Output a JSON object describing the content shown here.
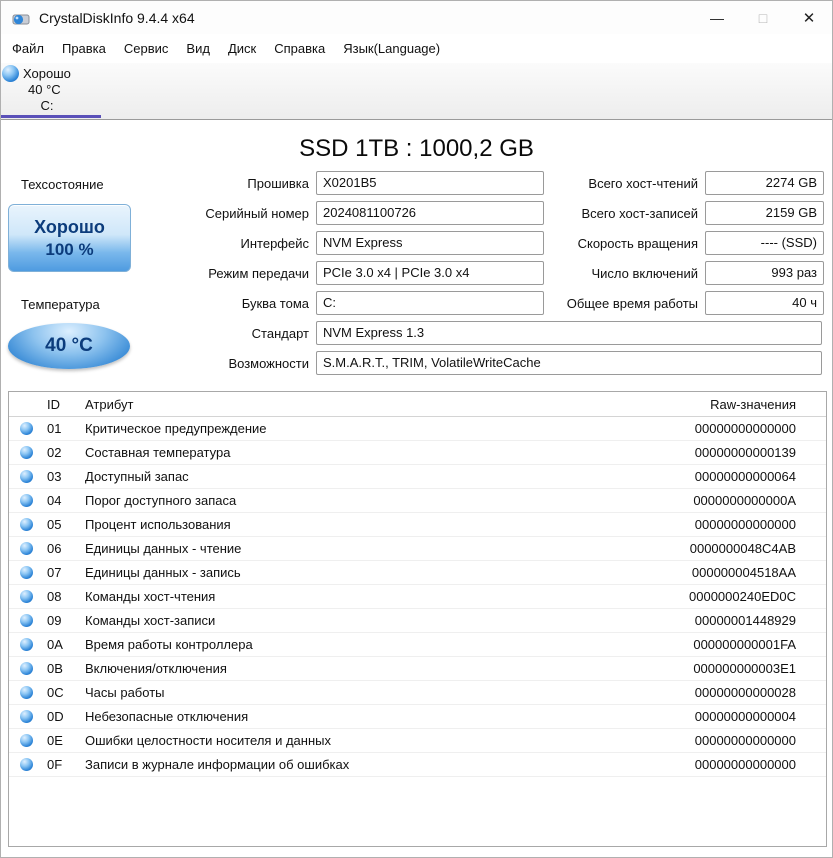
{
  "colors": {
    "status_blue": "#2f86d8",
    "drive_tab_underline": "#5a50b8",
    "health_text": "#0c3c7c"
  },
  "window": {
    "title": "CrystalDiskInfo 9.4.4 x64",
    "icons": {
      "minimize": "—",
      "maximize": "□",
      "close": "✕"
    }
  },
  "menu": {
    "items": [
      {
        "id": "file",
        "label": "Файл"
      },
      {
        "id": "edit",
        "label": "Правка"
      },
      {
        "id": "function",
        "label": "Сервис"
      },
      {
        "id": "view",
        "label": "Вид"
      },
      {
        "id": "disk",
        "label": "Диск"
      },
      {
        "id": "help",
        "label": "Справка"
      },
      {
        "id": "language",
        "label": "Язык(Language)"
      }
    ]
  },
  "drive_bar": {
    "status": "Хорошо",
    "temperature": "40 °C",
    "letter": "C:"
  },
  "main": {
    "title": "SSD 1TB : 1000,2 GB",
    "health": {
      "label": "Техсостояние",
      "status": "Хорошо",
      "percent": "100 %"
    },
    "temperature": {
      "label": "Температура",
      "value": "40 °C"
    },
    "fields_mid": [
      {
        "id": "firmware",
        "label": "Прошивка",
        "value": "X0201B5"
      },
      {
        "id": "serial_number",
        "label": "Серийный номер",
        "value": "2024081100726"
      },
      {
        "id": "interface",
        "label": "Интерфейс",
        "value": "NVM Express"
      },
      {
        "id": "transfer_mode",
        "label": "Режим передачи",
        "value": "PCIe 3.0 x4 | PCIe 3.0 x4"
      },
      {
        "id": "drive_letter",
        "label": "Буква тома",
        "value": "C:"
      }
    ],
    "fields_wide": [
      {
        "id": "standard",
        "label": "Стандарт",
        "value": "NVM Express 1.3"
      },
      {
        "id": "features",
        "label": "Возможности",
        "value": "S.M.A.R.T., TRIM, VolatileWriteCache"
      }
    ],
    "fields_right": [
      {
        "id": "total_host_reads",
        "label": "Всего хост-чтений",
        "value": "2274 GB"
      },
      {
        "id": "total_host_writes",
        "label": "Всего хост-записей",
        "value": "2159 GB"
      },
      {
        "id": "rotation_rate",
        "label": "Скорость вращения",
        "value": "---- (SSD)"
      },
      {
        "id": "power_on_count",
        "label": "Число включений",
        "value": "993 раз"
      },
      {
        "id": "power_on_hours",
        "label": "Общее время работы",
        "value": "40 ч"
      }
    ]
  },
  "smart_table": {
    "headers": {
      "id": "ID",
      "attribute": "Атрибут",
      "raw": "Raw-значения"
    },
    "rows": [
      {
        "id": "01",
        "attribute": "Критическое предупреждение",
        "raw": "00000000000000"
      },
      {
        "id": "02",
        "attribute": "Составная температура",
        "raw": "00000000000139"
      },
      {
        "id": "03",
        "attribute": "Доступный запас",
        "raw": "00000000000064"
      },
      {
        "id": "04",
        "attribute": "Порог доступного запаса",
        "raw": "0000000000000A"
      },
      {
        "id": "05",
        "attribute": "Процент использования",
        "raw": "00000000000000"
      },
      {
        "id": "06",
        "attribute": "Единицы данных - чтение",
        "raw": "0000000048C4AB"
      },
      {
        "id": "07",
        "attribute": "Единицы данных - запись",
        "raw": "000000004518AA"
      },
      {
        "id": "08",
        "attribute": "Команды хост-чтения",
        "raw": "0000000240ED0C"
      },
      {
        "id": "09",
        "attribute": "Команды хост-записи",
        "raw": "00000001448929"
      },
      {
        "id": "0A",
        "attribute": "Время работы контроллера",
        "raw": "000000000001FA"
      },
      {
        "id": "0B",
        "attribute": "Включения/отключения",
        "raw": "000000000003E1"
      },
      {
        "id": "0C",
        "attribute": "Часы работы",
        "raw": "00000000000028"
      },
      {
        "id": "0D",
        "attribute": "Небезопасные отключения",
        "raw": "00000000000004"
      },
      {
        "id": "0E",
        "attribute": "Ошибки целостности носителя и данных",
        "raw": "00000000000000"
      },
      {
        "id": "0F",
        "attribute": "Записи в журнале информации об ошибках",
        "raw": "00000000000000"
      }
    ]
  }
}
